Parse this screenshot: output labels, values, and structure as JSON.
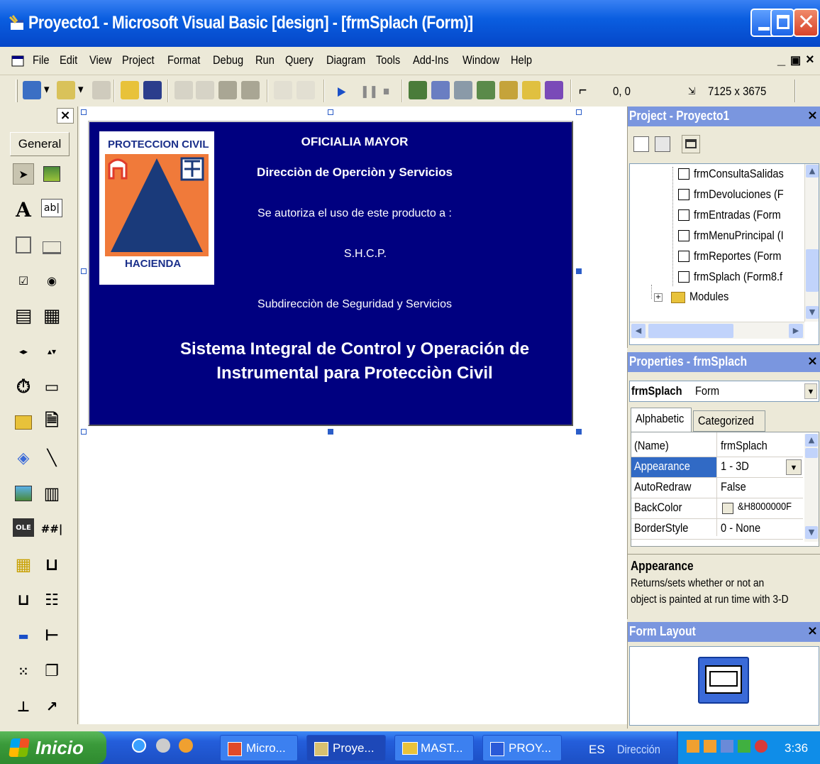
{
  "window": {
    "title": "Proyecto1 - Microsoft Visual Basic [design] - [frmSplach (Form)]"
  },
  "menu": [
    "File",
    "Edit",
    "View",
    "Project",
    "Format",
    "Debug",
    "Run",
    "Query",
    "Diagram",
    "Tools",
    "Add-Ins",
    "Window",
    "Help"
  ],
  "toolbar": {
    "position": "0, 0",
    "size": "7125 x 3675"
  },
  "toolbox": {
    "tab": "General"
  },
  "form": {
    "logo_top": "PROTECCION CIVIL",
    "logo_bottom": "HACIENDA",
    "line1": "OFICIALIA MAYOR",
    "line2": "Direcciòn de Operciòn y Servicios",
    "line3": "Se autoriza el uso de este producto a :",
    "line4": "S.H.C.P.",
    "line5": "Subdirecciòn de Seguridad y Servicios",
    "title1": "Sistema Integral de Control y Operación de",
    "title2": "Instrumental para Protecciòn Civil"
  },
  "project": {
    "title": "Project - Proyecto1",
    "items": [
      "frmConsultaSalidas",
      "frmDevoluciones (F",
      "frmEntradas (Form",
      "frmMenuPrincipal (I",
      "frmReportes (Form",
      "frmSplach (Form8.f",
      "Modules"
    ]
  },
  "properties": {
    "title": "Properties - frmSplach",
    "object": "frmSplach",
    "object_type": "Form",
    "tabs": [
      "Alphabetic",
      "Categorized"
    ],
    "rows": [
      {
        "name": "(Name)",
        "value": "frmSplach"
      },
      {
        "name": "Appearance",
        "value": "1 - 3D"
      },
      {
        "name": "AutoRedraw",
        "value": "False"
      },
      {
        "name": "BackColor",
        "value": "&H8000000F"
      },
      {
        "name": "BorderStyle",
        "value": "0 - None"
      }
    ],
    "desc_title": "Appearance",
    "desc_text1": "Returns/sets whether or not an",
    "desc_text2": "object is painted at run time with 3-D"
  },
  "form_layout": {
    "title": "Form Layout"
  },
  "taskbar": {
    "start": "Inicio",
    "tasks": [
      "Micro...",
      "Proye...",
      "MAST...",
      "PROY..."
    ],
    "lang": "ES",
    "address": "Dirección",
    "clock": "3:36"
  },
  "colors": {
    "form_bg": "#000080",
    "title_blue": "#0a5ee0",
    "pane_title": "#7a96df"
  }
}
